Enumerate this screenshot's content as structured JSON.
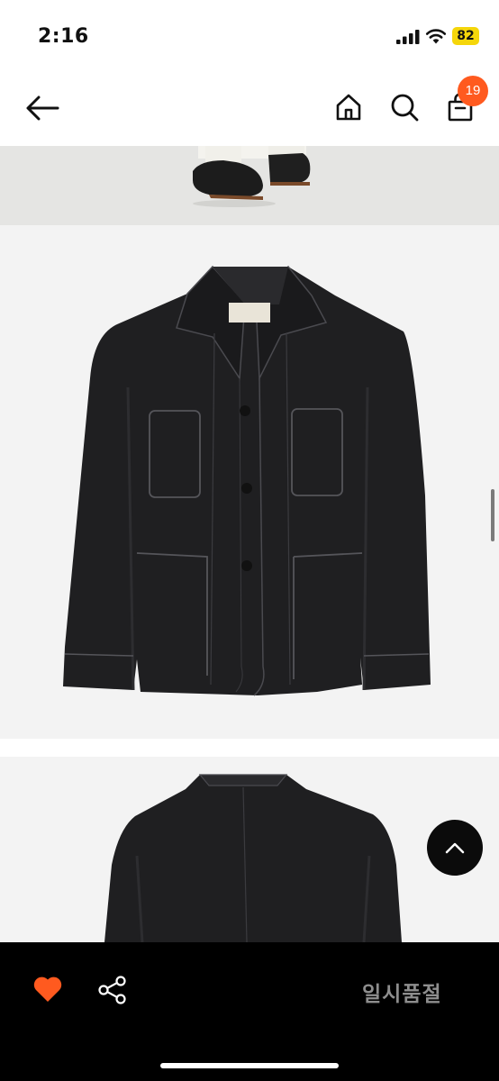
{
  "status_bar": {
    "time": "2:16",
    "battery": "82"
  },
  "header": {
    "cart_count": "19"
  },
  "bottom_bar": {
    "soldout_label": "일시품절"
  },
  "icons": {
    "back": "arrow-left-icon",
    "home": "home-icon",
    "search": "search-icon",
    "bag": "shopping-bag-icon",
    "like": "heart-icon",
    "share": "share-icon",
    "scroll_top": "chevron-up-icon"
  },
  "colors": {
    "accent": "#ff5a1f",
    "battery": "#f5d60a",
    "soldout_text": "#8e8e8e"
  }
}
